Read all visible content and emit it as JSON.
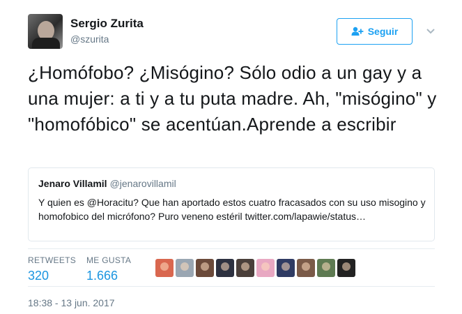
{
  "author": {
    "name": "Sergio Zurita",
    "handle": "@szurita"
  },
  "follow_button": {
    "label": "Seguir"
  },
  "tweet": {
    "text": "¿Homófobo? ¿Misógino? Sólo odio a un gay y a una mujer: a ti y a tu puta madre. Ah, \"misógino\" y \"homofóbico\" se acentúan.Aprende a escribir"
  },
  "quoted_tweet": {
    "name": "Jenaro Villamil",
    "handle": "@jenarovillamil",
    "text": "Y quien es @Horacitu? Que han aportado estos cuatro fracasados con su uso misogino y homofobico del micrófono? Puro veneno estéril twitter.com/lapawie/status…"
  },
  "stats": {
    "retweets_label": "RETWEETS",
    "retweets_value": "320",
    "likes_label": "ME GUSTA",
    "likes_value": "1.666"
  },
  "likers": [
    {
      "color": "#d9674f"
    },
    {
      "color": "#9aa6b2"
    },
    {
      "color": "#6b4a3a"
    },
    {
      "color": "#2d3140"
    },
    {
      "color": "#4a3f3a"
    },
    {
      "color": "#e8a8c2"
    },
    {
      "color": "#2f3b63"
    },
    {
      "color": "#7a5a48"
    },
    {
      "color": "#5e7a52"
    },
    {
      "color": "#222222"
    }
  ],
  "timestamp": "18:38 - 13 jun. 2017",
  "colors": {
    "accent": "#1da1f2",
    "link": "#1b95e0",
    "secondary_text": "#657786",
    "border": "#e1e8ed"
  }
}
